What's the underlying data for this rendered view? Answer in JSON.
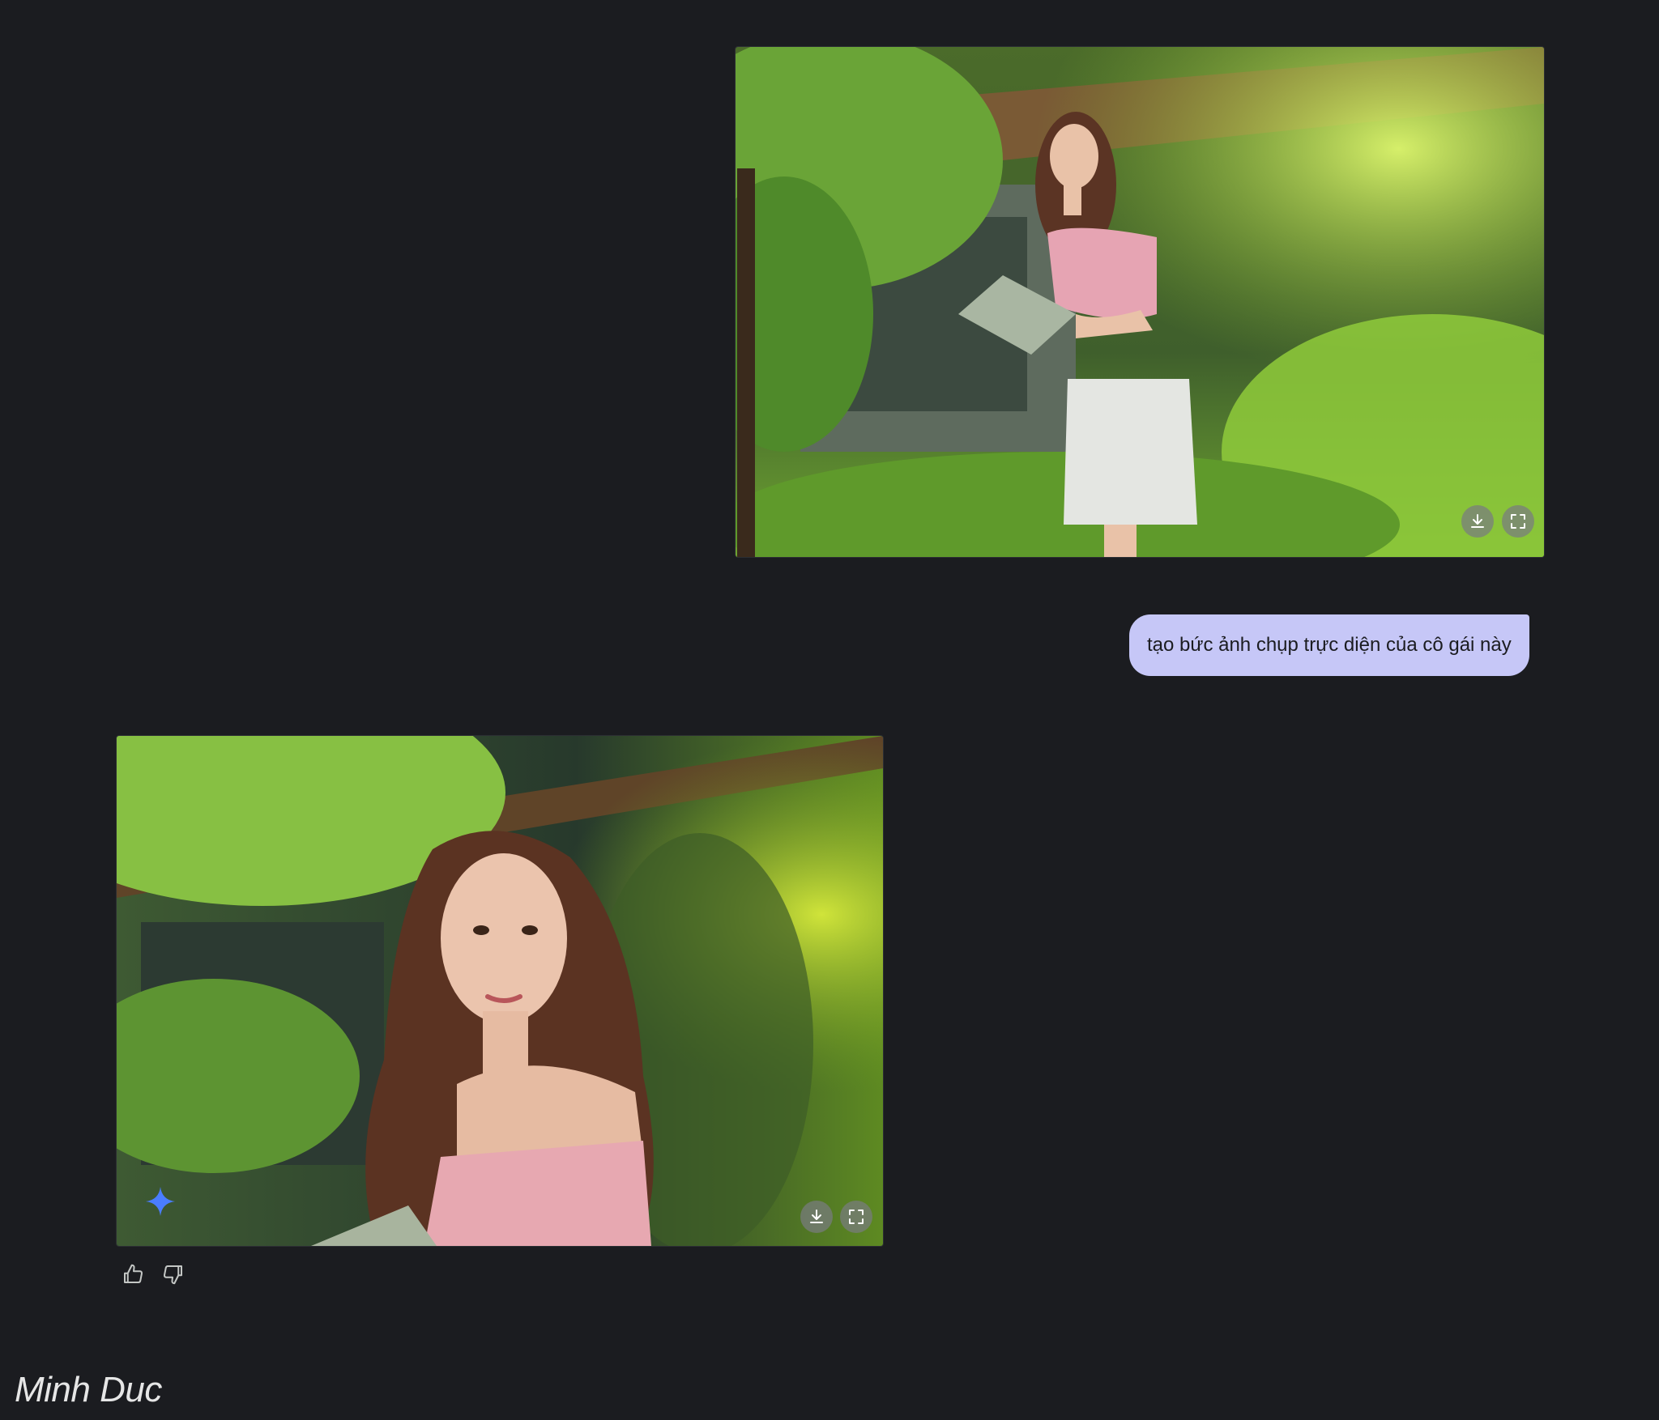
{
  "conversation": {
    "user_image": {
      "alt": "",
      "download_icon": "download-icon",
      "expand_icon": "fullscreen-icon"
    },
    "user_prompt": "tạo bức ảnh chụp trực diện của cô gái này",
    "generated_image": {
      "badge_icon": "sparkle-icon",
      "download_icon": "download-icon",
      "expand_icon": "fullscreen-icon"
    },
    "feedback": {
      "like_icon": "thumbs-up-icon",
      "dislike_icon": "thumbs-down-icon"
    }
  },
  "watermark": "Minh Duc",
  "colors": {
    "background": "#1b1c20",
    "prompt_bubble": "#c6c7f7",
    "sparkle_accent": "#4a7dff"
  }
}
